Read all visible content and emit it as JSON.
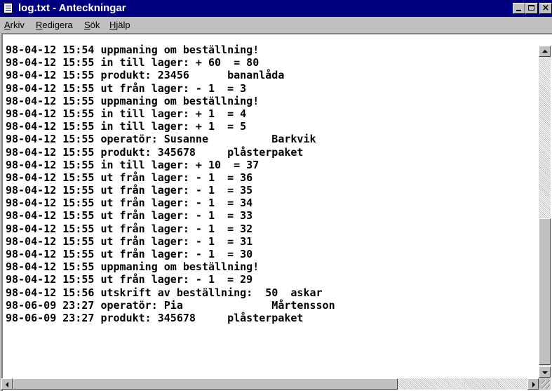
{
  "window": {
    "title": "log.txt - Anteckningar",
    "icon": "notepad-icon",
    "controls": {
      "minimize": "minimize-icon",
      "maximize": "maximize-icon",
      "close": "×"
    }
  },
  "menu": [
    {
      "accel": "A",
      "rest": "rkiv"
    },
    {
      "accel": "R",
      "rest": "edigera"
    },
    {
      "accel": "S",
      "rest": "ök"
    },
    {
      "accel": "H",
      "rest": "jälp"
    }
  ],
  "lines": [
    "98-04-12 15:54 uppmaning om beställning!",
    "98-04-12 15:55 in till lager: + 60  = 80",
    "98-04-12 15:55 produkt: 23456      bananlåda",
    "98-04-12 15:55 ut från lager: - 1  = 3",
    "98-04-12 15:55 uppmaning om beställning!",
    "98-04-12 15:55 in till lager: + 1  = 4",
    "98-04-12 15:55 in till lager: + 1  = 5",
    "98-04-12 15:55 operatör: Susanne          Barkvik",
    "98-04-12 15:55 produkt: 345678     plåsterpaket",
    "98-04-12 15:55 in till lager: + 10  = 37",
    "98-04-12 15:55 ut från lager: - 1  = 36",
    "98-04-12 15:55 ut från lager: - 1  = 35",
    "98-04-12 15:55 ut från lager: - 1  = 34",
    "98-04-12 15:55 ut från lager: - 1  = 33",
    "98-04-12 15:55 ut från lager: - 1  = 32",
    "98-04-12 15:55 ut från lager: - 1  = 31",
    "98-04-12 15:55 ut från lager: - 1  = 30",
    "98-04-12 15:55 uppmaning om beställning!",
    "98-04-12 15:55 ut från lager: - 1  = 29",
    "98-04-12 15:56 utskrift av beställning:  50  askar",
    "98-06-09 23:27 operatör: Pia              Mårtensson",
    "98-06-09 23:27 produkt: 345678     plåsterpaket"
  ],
  "colors": {
    "titlebar": "#000080",
    "chrome": "#c0c0c0",
    "text_bg": "#ffffff"
  }
}
